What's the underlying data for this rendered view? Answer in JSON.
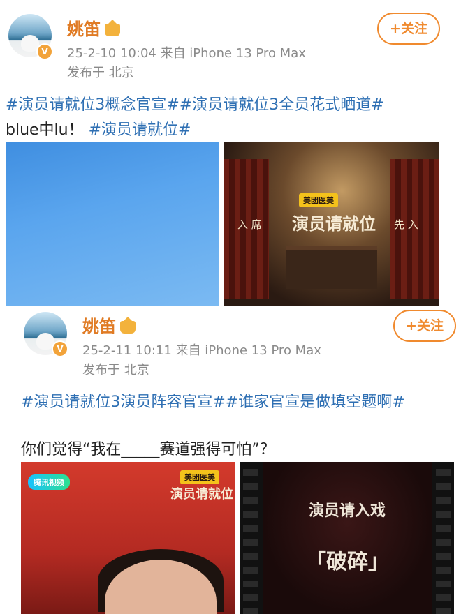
{
  "post1": {
    "username": "姚笛",
    "meta_line": "25-2-10 10:04  来自 iPhone 13 Pro Max",
    "location": "发布于 北京",
    "follow_label": "+关注",
    "tag1": "#演员请就位3概念官宣#",
    "tag2": "#演员请就位3全员花式晒道#",
    "plain_text": "blue中lu！",
    "tag3": "#演员请就位#",
    "stage_left_text": "入 席",
    "stage_right_text": "先 入",
    "sponsor": "美团医美",
    "show_title": "演员请就位"
  },
  "post2": {
    "username": "姚笛",
    "meta_line": "25-2-11 10:11  来自 iPhone 13 Pro Max",
    "location": "发布于 北京",
    "follow_label": "+关注",
    "tag1": "#演员请就位3演员阵容官宣#",
    "tag2": "#谁家官宣是做填空题啊#",
    "question": "你们觉得“我在_____赛道强得可怕”？",
    "tencent_label": "腾讯视频",
    "sponsor": "美团医美",
    "show_title": "演员请就位",
    "film_title": "演员请入戏",
    "film_word": "「破碎」"
  },
  "colors": {
    "accent": "#f08a2e",
    "topic": "#2e6fb3",
    "meta": "#8a8a8a"
  }
}
